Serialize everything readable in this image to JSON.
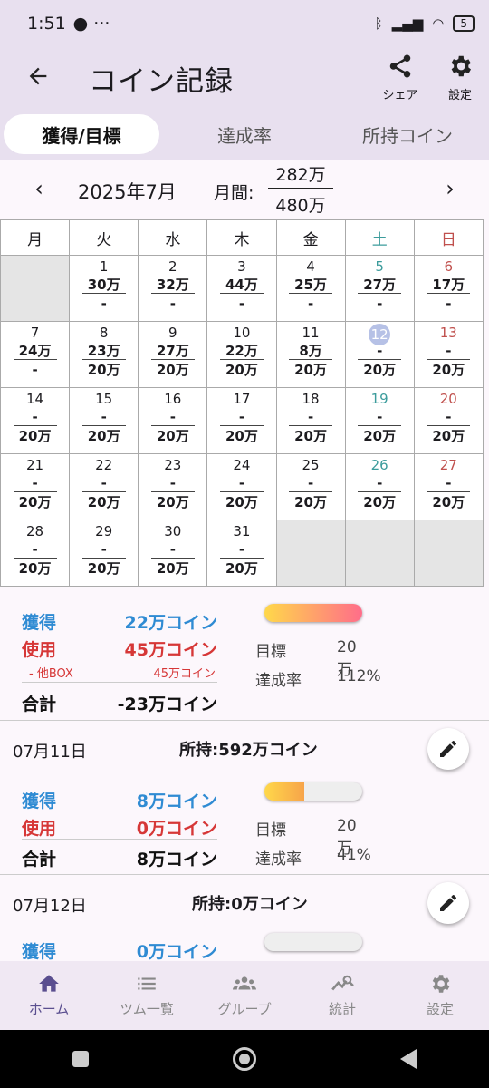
{
  "status": {
    "time": "1:51",
    "battery": "5"
  },
  "appbar": {
    "title": "コイン記録",
    "share_label": "シェア",
    "settings_label": "設定"
  },
  "tabs": [
    "獲得/目標",
    "達成率",
    "所持コイン"
  ],
  "month": {
    "label": "2025年7月",
    "monthly_label": "月間:",
    "earned": "282万",
    "target": "480万"
  },
  "weekdays": [
    "月",
    "火",
    "水",
    "木",
    "金",
    "土",
    "日"
  ],
  "calendar": [
    [
      null,
      {
        "d": "1",
        "g": "30万",
        "t": "-"
      },
      {
        "d": "2",
        "g": "32万",
        "t": "-"
      },
      {
        "d": "3",
        "g": "44万",
        "t": "-"
      },
      {
        "d": "4",
        "g": "25万",
        "t": "-"
      },
      {
        "d": "5",
        "g": "27万",
        "t": "-"
      },
      {
        "d": "6",
        "g": "17万",
        "t": "-"
      }
    ],
    [
      {
        "d": "7",
        "g": "24万",
        "t": "-"
      },
      {
        "d": "8",
        "g": "23万",
        "t": "20万"
      },
      {
        "d": "9",
        "g": "27万",
        "t": "20万"
      },
      {
        "d": "10",
        "g": "22万",
        "t": "20万"
      },
      {
        "d": "11",
        "g": "8万",
        "t": "20万"
      },
      {
        "d": "12",
        "g": "-",
        "t": "20万",
        "today": true
      },
      {
        "d": "13",
        "g": "-",
        "t": "20万"
      }
    ],
    [
      {
        "d": "14",
        "g": "-",
        "t": "20万"
      },
      {
        "d": "15",
        "g": "-",
        "t": "20万"
      },
      {
        "d": "16",
        "g": "-",
        "t": "20万"
      },
      {
        "d": "17",
        "g": "-",
        "t": "20万"
      },
      {
        "d": "18",
        "g": "-",
        "t": "20万"
      },
      {
        "d": "19",
        "g": "-",
        "t": "20万"
      },
      {
        "d": "20",
        "g": "-",
        "t": "20万"
      }
    ],
    [
      {
        "d": "21",
        "g": "-",
        "t": "20万"
      },
      {
        "d": "22",
        "g": "-",
        "t": "20万"
      },
      {
        "d": "23",
        "g": "-",
        "t": "20万"
      },
      {
        "d": "24",
        "g": "-",
        "t": "20万"
      },
      {
        "d": "25",
        "g": "-",
        "t": "20万"
      },
      {
        "d": "26",
        "g": "-",
        "t": "20万"
      },
      {
        "d": "27",
        "g": "-",
        "t": "20万"
      }
    ],
    [
      {
        "d": "28",
        "g": "-",
        "t": "20万"
      },
      {
        "d": "29",
        "g": "-",
        "t": "20万"
      },
      {
        "d": "30",
        "g": "-",
        "t": "20万"
      },
      {
        "d": "31",
        "g": "-",
        "t": "20万"
      },
      null,
      null,
      null
    ]
  ],
  "entries": [
    {
      "date": "",
      "owned": "",
      "earned_label": "獲得",
      "earned": "22万コイン",
      "used_label": "使用",
      "used": "45万コイン",
      "sub_label": "- 他BOX",
      "sub_value": "45万コイン",
      "total_label": "合計",
      "total": "-23万コイン",
      "target_label": "目標",
      "target": "20万",
      "rate_label": "達成率",
      "rate": "112%",
      "progress": 1.0
    },
    {
      "date": "07月11日",
      "owned": "所持:592万コイン",
      "earned_label": "獲得",
      "earned": "8万コイン",
      "used_label": "使用",
      "used": "0万コイン",
      "total_label": "合計",
      "total": "8万コイン",
      "target_label": "目標",
      "target": "20万",
      "rate_label": "達成率",
      "rate": "41%",
      "progress": 0.41
    },
    {
      "date": "07月12日",
      "owned": "所持:0万コイン",
      "earned_label": "獲得",
      "earned": "0万コイン",
      "progress": 0
    }
  ],
  "bottom_nav": [
    "ホーム",
    "ツム一覧",
    "グループ",
    "統計",
    "設定"
  ],
  "colors": {
    "accent": "#5a4e8f",
    "earned": "#2f8bd3",
    "used": "#d63737",
    "saturday": "#3c9c9c",
    "sunday": "#c0504d"
  }
}
